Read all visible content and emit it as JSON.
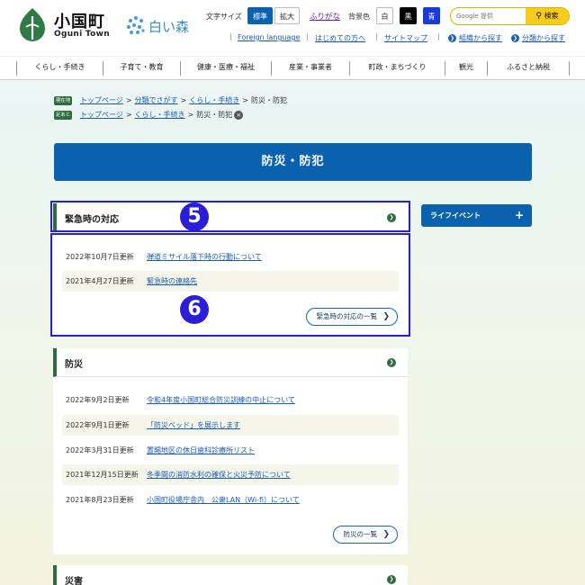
{
  "header": {
    "site_name": "小国町",
    "site_roman": "Oguni Town",
    "sub_logo_text": "白い森",
    "text_size_label": "文字サイズ",
    "text_size_standard": "標準",
    "text_size_large": "拡大",
    "furigana": "ふりがな",
    "bg_color_label": "背景色",
    "bg_white": "白",
    "bg_black": "黒",
    "bg_blue": "青",
    "search_placeholder": "Google 提供",
    "search_button": "検索",
    "links": {
      "foreign_language": "Foreign language",
      "first_visit": "はじめての方へ",
      "sitemap": "サイトマップ",
      "find_by_org": "組織から探す",
      "find_by_category": "分類から探す"
    }
  },
  "nav": [
    "くらし・手続き",
    "子育て・教育",
    "健康・医療・福祉",
    "産業・事業者",
    "町政・まちづくり",
    "観光",
    "ふるさと納税"
  ],
  "breadcrumbs": {
    "current": {
      "tag": "現在地",
      "items": [
        "トップページ",
        "分類でさがす",
        "くらし・手続き"
      ],
      "last": "防災・防犯"
    },
    "history": {
      "tag": "足あと",
      "items": [
        "トップページ",
        "くらし・手続き"
      ],
      "last": "防災・防犯"
    }
  },
  "page_title": "防災・防犯",
  "sections": [
    {
      "title": "緊急時の対応",
      "items": [
        {
          "date": "2022年10月7日更新",
          "title": "弾道ミサイル落下時の行動について"
        },
        {
          "date": "2021年4月27日更新",
          "title": "緊急時の連絡先"
        }
      ],
      "more_label": "緊急時の対応の一覧"
    },
    {
      "title": "防災",
      "items": [
        {
          "date": "2022年9月2日更新",
          "title": "令和4年度小国町総合防災訓練の中止について"
        },
        {
          "date": "2022年9月1日更新",
          "title": "「防災ベッド」を展示します"
        },
        {
          "date": "2022年3月31日更新",
          "title": "置賜地区の休日歯科診療所リスト"
        },
        {
          "date": "2021年12月15日更新",
          "title": "冬季間の消防水利の確保と火災予防について"
        },
        {
          "date": "2021年8月23日更新",
          "title": "小国町役場庁舎内　公衆LAN（Wi-fi）について"
        }
      ],
      "more_label": "防災の一覧"
    },
    {
      "title": "災害"
    }
  ],
  "side": {
    "life_event": "ライフイベント"
  },
  "annotations": {
    "a5": "5",
    "a6": "6"
  }
}
